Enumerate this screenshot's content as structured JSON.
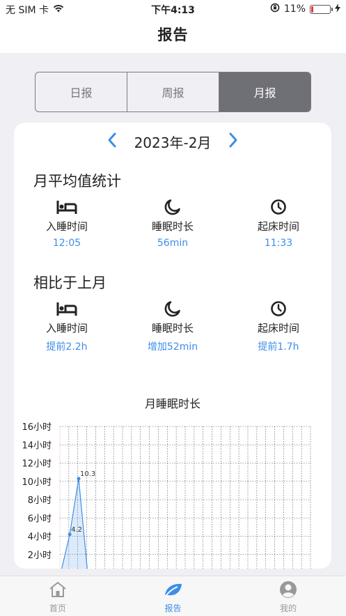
{
  "status_bar": {
    "carrier": "无 SIM 卡",
    "time": "下午4:13",
    "battery_percent": "11%",
    "battery_level": 0.11
  },
  "nav": {
    "title": "报告"
  },
  "segment": {
    "tabs": [
      "日报",
      "周报",
      "月报"
    ],
    "active_index": 2
  },
  "month_selector": {
    "label": "2023年-2月"
  },
  "monthly_average": {
    "title": "月平均值统计",
    "items": [
      {
        "icon": "bed-icon",
        "label": "入睡时间",
        "value": "12:05"
      },
      {
        "icon": "moon-icon",
        "label": "睡眠时长",
        "value": "56min"
      },
      {
        "icon": "clock-icon",
        "label": "起床时间",
        "value": "11:33"
      }
    ]
  },
  "compare": {
    "title": "相比于上月",
    "items": [
      {
        "icon": "bed-icon",
        "label": "入睡时间",
        "value": "提前2.2h"
      },
      {
        "icon": "moon-icon",
        "label": "睡眠时长",
        "value": "增加52min"
      },
      {
        "icon": "clock-icon",
        "label": "起床时间",
        "value": "提前1.7h"
      }
    ]
  },
  "chart_data": {
    "type": "area",
    "title": "月睡眠时长",
    "ylim": [
      0,
      16
    ],
    "yticks": [
      "16小时",
      "14小时",
      "12小时",
      "10小时",
      "8小时",
      "6小时",
      "4小时",
      "2小时"
    ],
    "ytick_values": [
      16,
      14,
      12,
      10,
      8,
      6,
      4,
      2
    ],
    "grid": true,
    "series": [
      {
        "x": [
          0,
          1,
          2,
          3
        ],
        "values": [
          0,
          4.2,
          10.3,
          0
        ],
        "labels": [
          "",
          "4.2",
          "10.3",
          ""
        ]
      }
    ],
    "x_count": 28
  },
  "colors": {
    "accent": "#3d8ee8",
    "segment_active": "#6f6f76"
  },
  "tabbar": {
    "items": [
      {
        "icon": "home-icon",
        "label": "首页"
      },
      {
        "icon": "leaf-icon",
        "label": "报告"
      },
      {
        "icon": "user-icon",
        "label": "我的"
      }
    ],
    "active_index": 1
  }
}
